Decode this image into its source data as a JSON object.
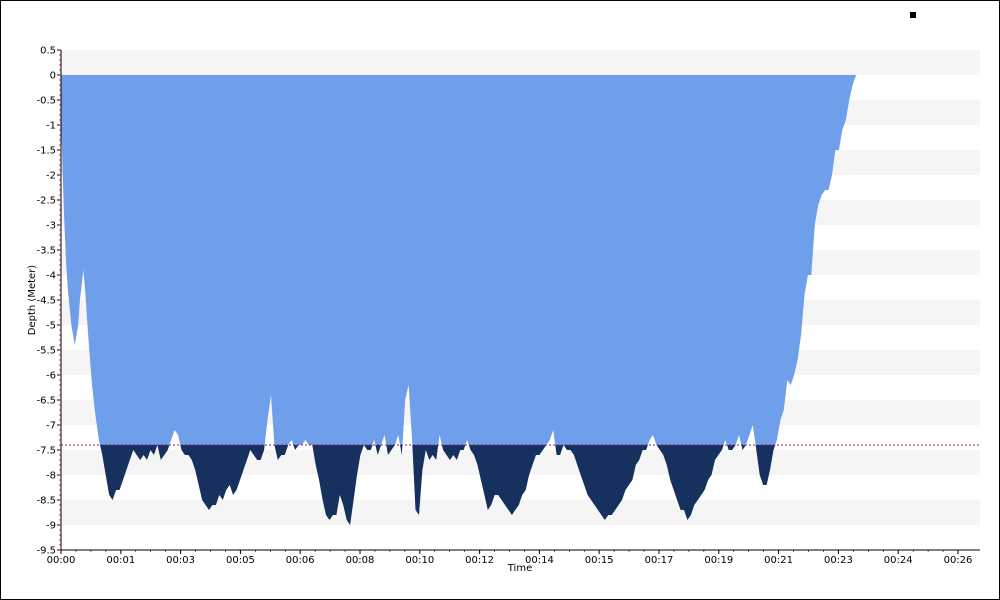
{
  "chart_data": {
    "type": "area",
    "title": "",
    "xlabel": "Time",
    "ylabel": "Depth (Meter)",
    "x_ticks": [
      "00:00",
      "00:01",
      "00:03",
      "00:05",
      "00:06",
      "00:08",
      "00:10",
      "00:12",
      "00:14",
      "00:15",
      "00:17",
      "00:19",
      "00:21",
      "00:23",
      "00:24",
      "00:26"
    ],
    "y_ticks": [
      "0.5",
      "0",
      "-0.5",
      "-1",
      "-1.5",
      "-2",
      "-2.5",
      "-3",
      "-3.5",
      "-4",
      "-4.5",
      "-5",
      "-5.5",
      "-6",
      "-6.5",
      "-7",
      "-7.5",
      "-8",
      "-8.5",
      "-9",
      "-9.5"
    ],
    "ylim": [
      -9.5,
      0.5
    ],
    "xlim_minutes": [
      0,
      26.7
    ],
    "threshold_depth": -7.4,
    "grid": "horizontal bands",
    "legend": "top-right",
    "colors": {
      "upper_fill": "#6f9fea",
      "lower_fill": "#17315f",
      "band": "#f5f5f5",
      "threshold_line": "#8a1a6a",
      "axis": "#000000",
      "minor_tick": "#cc0000",
      "legend_marker": "#000000"
    },
    "series": [
      {
        "x_minutes": [
          0,
          0.05,
          0.1,
          0.15,
          0.2,
          0.3,
          0.4,
          0.5,
          0.55,
          0.6,
          0.65,
          0.7,
          0.75,
          0.8,
          0.9,
          1.0,
          1.1,
          1.2,
          1.3,
          1.4,
          1.5,
          1.6,
          1.7,
          1.8,
          1.9,
          2.0,
          2.1,
          2.2,
          2.3,
          2.4,
          2.5,
          2.6,
          2.7,
          2.8,
          2.9,
          3.0,
          3.1,
          3.2,
          3.3,
          3.4,
          3.5,
          3.6,
          3.7,
          3.8,
          3.9,
          4.0,
          4.1,
          4.2,
          4.3,
          4.4,
          4.5,
          4.6,
          4.7,
          4.8,
          4.9,
          5.0,
          5.1,
          5.2,
          5.3,
          5.4,
          5.5,
          5.6,
          5.7,
          5.8,
          5.9,
          6.0,
          6.1,
          6.2,
          6.3,
          6.4,
          6.5,
          6.6,
          6.7,
          6.8,
          6.9,
          7.0,
          7.1,
          7.2,
          7.3,
          7.4,
          7.5,
          7.6,
          7.7,
          7.8,
          7.9,
          8.0,
          8.1,
          8.2,
          8.3,
          8.4,
          8.5,
          8.6,
          8.7,
          8.8,
          8.9,
          9.0,
          9.1,
          9.2,
          9.3,
          9.4,
          9.5,
          9.6,
          9.7,
          9.8,
          9.9,
          10.0,
          10.1,
          10.2,
          10.3,
          10.4,
          10.5,
          10.6,
          10.7,
          10.8,
          10.9,
          11.0,
          11.1,
          11.2,
          11.3,
          11.4,
          11.5,
          11.6,
          11.7,
          11.8,
          11.9,
          12.0,
          12.1,
          12.2,
          12.3,
          12.4,
          12.5,
          12.6,
          12.7,
          12.8,
          12.9,
          13.0,
          13.1,
          13.2,
          13.3,
          13.4,
          13.5,
          13.6,
          13.7,
          13.8,
          13.9,
          14.0,
          14.1,
          14.2,
          14.3,
          14.4,
          14.5,
          14.6,
          14.7,
          14.8,
          14.9,
          15.0,
          15.1,
          15.2,
          15.3,
          15.4,
          15.5,
          15.6,
          15.7,
          15.8,
          15.9,
          16.0,
          16.1,
          16.2,
          16.3,
          16.4,
          16.5,
          16.6,
          16.7,
          16.8,
          16.9,
          17.0,
          17.1,
          17.2,
          17.3,
          17.4,
          17.5,
          17.6,
          17.7,
          17.8,
          17.9,
          18.0,
          18.1,
          18.2,
          18.3,
          18.4,
          18.5,
          18.6,
          18.7,
          18.8,
          18.9,
          19.0,
          19.1,
          19.2,
          19.3,
          19.4,
          19.5,
          19.6,
          19.7,
          19.8,
          19.9,
          20.0,
          20.1,
          20.2,
          20.3,
          20.4,
          20.5,
          20.6,
          20.7,
          20.8,
          20.9,
          21.0,
          21.1,
          21.2,
          21.3,
          21.4,
          21.5,
          21.6,
          21.7,
          21.8,
          21.9,
          22.0,
          22.1,
          22.2,
          22.3,
          22.4,
          22.5,
          22.6,
          22.7,
          22.8,
          22.9,
          23.0,
          23.1,
          23.2,
          23.3,
          23.4,
          23.5,
          23.6,
          23.7,
          23.8,
          23.9,
          24.0,
          24.1,
          24.2,
          24.3,
          24.4,
          24.5,
          24.6,
          24.7,
          24.8,
          24.9,
          25.0,
          25.1,
          25.2,
          25.3,
          25.4,
          25.5,
          25.6,
          25.7,
          25.8,
          25.9,
          26.0,
          26.1,
          26.2,
          26.3,
          26.4,
          26.5,
          26.6,
          26.65,
          26.7
        ],
        "y": [
          -0.8,
          -2.0,
          -3.0,
          -3.8,
          -4.3,
          -5.0,
          -5.4,
          -5.0,
          -4.5,
          -4.2,
          -3.9,
          -4.3,
          -4.8,
          -5.3,
          -6.2,
          -6.8,
          -7.3,
          -7.6,
          -8.0,
          -8.4,
          -8.5,
          -8.3,
          -8.3,
          -8.1,
          -7.9,
          -7.7,
          -7.5,
          -7.6,
          -7.7,
          -7.6,
          -7.7,
          -7.5,
          -7.6,
          -7.4,
          -7.7,
          -7.6,
          -7.5,
          -7.3,
          -7.1,
          -7.2,
          -7.5,
          -7.6,
          -7.6,
          -7.7,
          -7.9,
          -8.2,
          -8.5,
          -8.6,
          -8.7,
          -8.6,
          -8.6,
          -8.4,
          -8.5,
          -8.3,
          -8.2,
          -8.4,
          -8.3,
          -8.1,
          -7.9,
          -7.7,
          -7.5,
          -7.6,
          -7.7,
          -7.7,
          -7.5,
          -6.9,
          -6.4,
          -7.4,
          -7.7,
          -7.6,
          -7.6,
          -7.4,
          -7.3,
          -7.5,
          -7.4,
          -7.4,
          -7.3,
          -7.4,
          -7.4,
          -7.8,
          -8.1,
          -8.5,
          -8.8,
          -8.9,
          -8.8,
          -8.8,
          -8.4,
          -8.6,
          -8.9,
          -9.0,
          -8.5,
          -8.0,
          -7.6,
          -7.4,
          -7.5,
          -7.5,
          -7.3,
          -7.6,
          -7.4,
          -7.2,
          -7.6,
          -7.5,
          -7.4,
          -7.2,
          -7.6,
          -6.5,
          -6.2,
          -7.3,
          -8.7,
          -8.8,
          -7.9,
          -7.5,
          -7.7,
          -7.6,
          -7.7,
          -7.2,
          -7.5,
          -7.6,
          -7.7,
          -7.6,
          -7.7,
          -7.5,
          -7.5,
          -7.3,
          -7.5,
          -7.6,
          -7.8,
          -8.1,
          -8.4,
          -8.7,
          -8.6,
          -8.4,
          -8.4,
          -8.5,
          -8.6,
          -8.7,
          -8.8,
          -8.7,
          -8.6,
          -8.4,
          -8.3,
          -8.0,
          -7.8,
          -7.6,
          -7.6,
          -7.5,
          -7.4,
          -7.3,
          -7.1,
          -7.6,
          -7.6,
          -7.4,
          -7.5,
          -7.5,
          -7.6,
          -7.8,
          -8.0,
          -8.2,
          -8.4,
          -8.5,
          -8.6,
          -8.7,
          -8.8,
          -8.9,
          -8.8,
          -8.8,
          -8.7,
          -8.6,
          -8.5,
          -8.3,
          -8.2,
          -8.1,
          -7.8,
          -7.7,
          -7.5,
          -7.5,
          -7.3,
          -7.2,
          -7.4,
          -7.5,
          -7.6,
          -7.8,
          -8.1,
          -8.3,
          -8.5,
          -8.7,
          -8.7,
          -8.9,
          -8.8,
          -8.6,
          -8.5,
          -8.4,
          -8.3,
          -8.1,
          -8.0,
          -7.7,
          -7.6,
          -7.5,
          -7.3,
          -7.5,
          -7.5,
          -7.4,
          -7.2,
          -7.5,
          -7.4,
          -7.2,
          -7.0,
          -7.5,
          -8.0,
          -8.2,
          -8.2,
          -7.9,
          -7.5,
          -7.3,
          -6.9,
          -6.7,
          -6.1,
          -6.2,
          -6.0,
          -5.7,
          -5.2,
          -4.4,
          -4.0,
          -4.0,
          -3.0,
          -2.6,
          -2.4,
          -2.3,
          -2.3,
          -2.0,
          -1.5,
          -1.5,
          -1.1,
          -0.9,
          -0.5,
          -0.2,
          0
        ]
      }
    ]
  }
}
